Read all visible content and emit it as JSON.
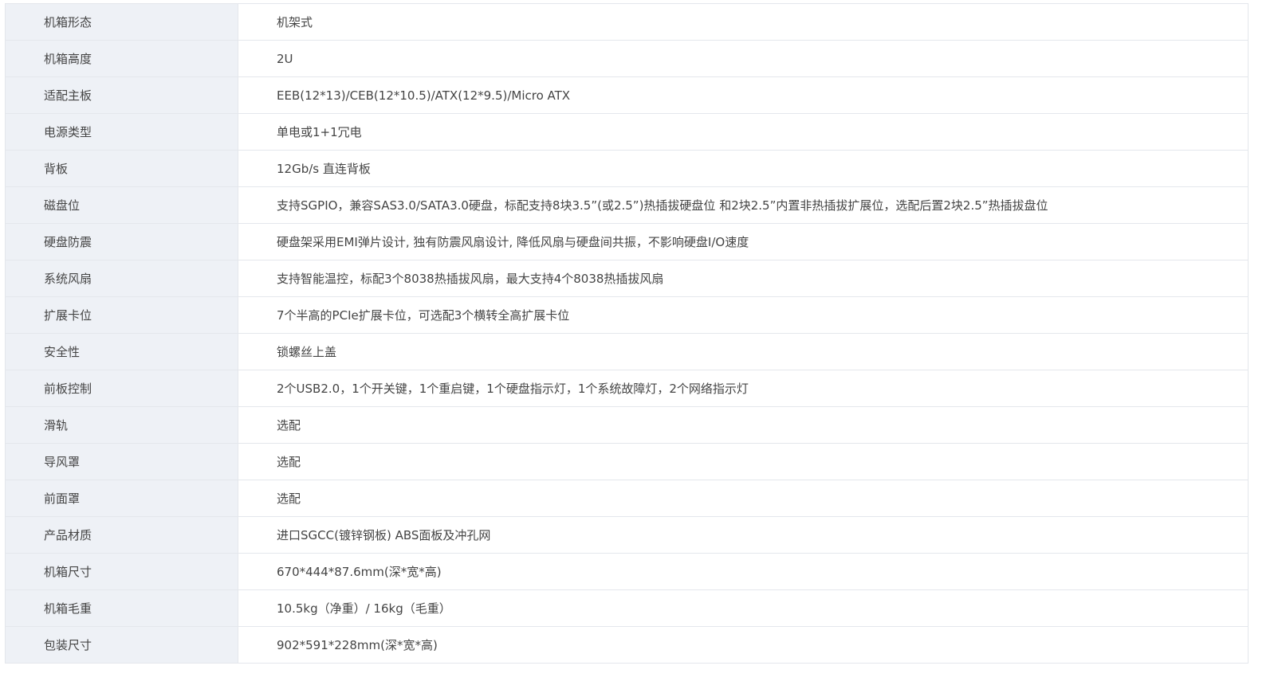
{
  "spec_rows": [
    {
      "label": "机箱形态",
      "value": "机架式"
    },
    {
      "label": "机箱高度",
      "value": "2U"
    },
    {
      "label": "适配主板",
      "value": "EEB(12*13)/CEB(12*10.5)/ATX(12*9.5)/Micro ATX"
    },
    {
      "label": "电源类型",
      "value": "单电或1+1冗电"
    },
    {
      "label": "背板",
      "value": "12Gb/s 直连背板"
    },
    {
      "label": "磁盘位",
      "value": "支持SGPIO，兼容SAS3.0/SATA3.0硬盘，标配支持8块3.5”(或2.5”)热插拔硬盘位 和2块2.5”内置非热插拔扩展位，选配后置2块2.5”热插拔盘位"
    },
    {
      "label": "硬盘防震",
      "value": "硬盘架采用EMI弹片设计, 独有防震风扇设计, 降低风扇与硬盘间共振，不影响硬盘I/O速度"
    },
    {
      "label": "系统风扇",
      "value": "支持智能温控，标配3个8038热插拔风扇，最大支持4个8038热插拔风扇"
    },
    {
      "label": "扩展卡位",
      "value": "7个半高的PCIe扩展卡位，可选配3个横转全高扩展卡位"
    },
    {
      "label": "安全性",
      "value": "锁螺丝上盖"
    },
    {
      "label": "前板控制",
      "value": "2个USB2.0，1个开关键，1个重启键，1个硬盘指示灯，1个系统故障灯，2个网络指示灯"
    },
    {
      "label": "滑轨",
      "value": "选配"
    },
    {
      "label": "导风罩",
      "value": "选配"
    },
    {
      "label": "前面罩",
      "value": "选配"
    },
    {
      "label": "产品材质",
      "value": "进口SGCC(镀锌钢板) ABS面板及冲孔网"
    },
    {
      "label": "机箱尺寸",
      "value": "670*444*87.6mm(深*宽*高)"
    },
    {
      "label": "机箱毛重",
      "value": "10.5kg（净重）/ 16kg（毛重）"
    },
    {
      "label": "包装尺寸",
      "value": "902*591*228mm(深*宽*高)"
    }
  ]
}
